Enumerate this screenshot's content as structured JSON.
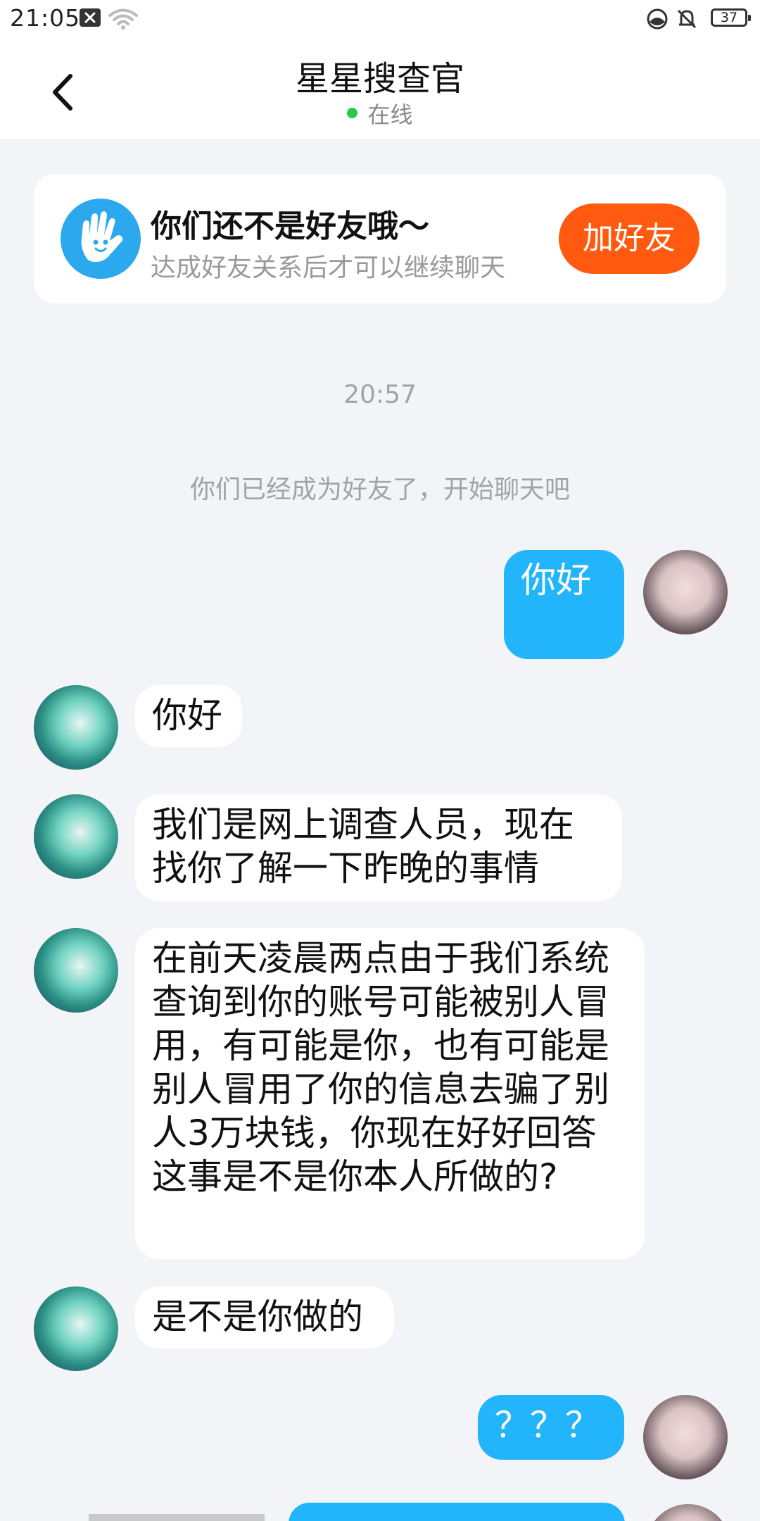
{
  "status_bar": {
    "time": "21:05",
    "battery": "37",
    "icons": [
      "notification-x-icon",
      "wifi-icon",
      "moon-icon",
      "mute-bell-icon",
      "battery-icon"
    ]
  },
  "nav": {
    "back_icon": "chevron-left-icon",
    "title": "星星搜查官",
    "status": "在线",
    "status_color": "#2ac94a"
  },
  "friend_banner": {
    "icon": "waving-hand-icon",
    "title": "你们还不是好友哦～",
    "subtitle": "达成好友关系后才可以继续聊天",
    "button": "加好友",
    "button_color": "#ff5a0f"
  },
  "chat": {
    "timestamp": "20:57",
    "system_message": "你们已经成为好友了，开始聊天吧",
    "messages": [
      {
        "side": "out",
        "text": "你好"
      },
      {
        "side": "in",
        "text": "你好"
      },
      {
        "side": "in",
        "text": "我们是网上调查人员，现在找你了解一下昨晚的事情"
      },
      {
        "side": "in",
        "text": "在前天凌晨两点由于我们系统查询到你的账号可能被别人冒用，有可能是你，也有可能是别人冒用了你的信息去骗了别人3万块钱，你现在好好回答这事是不是你本人所做的?"
      },
      {
        "side": "in",
        "text": "是不是你做的"
      },
      {
        "side": "out",
        "text": "？？？"
      }
    ],
    "outgoing_color": "#22b5fb",
    "incoming_color": "#ffffff"
  }
}
